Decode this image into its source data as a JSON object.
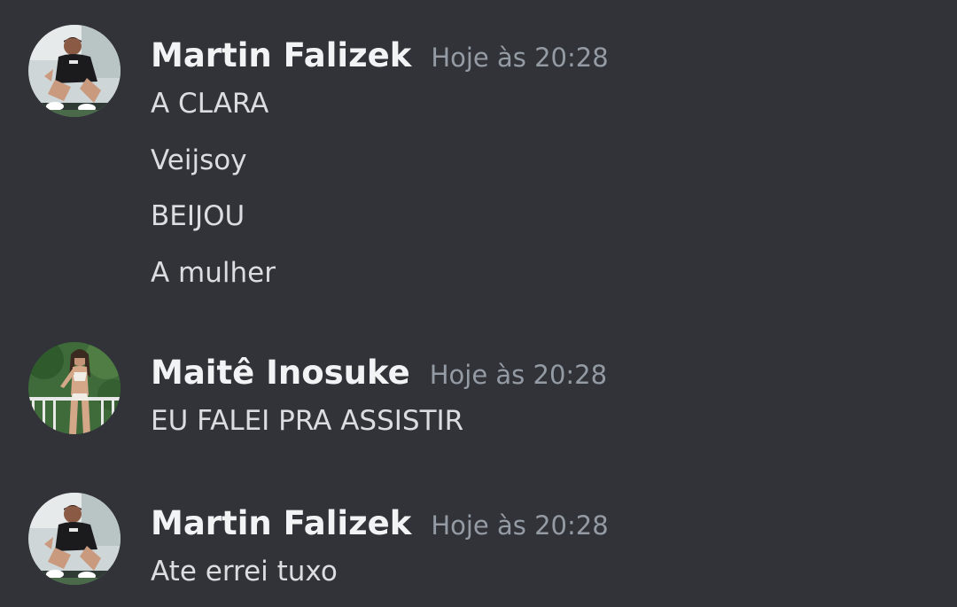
{
  "messages": [
    {
      "author": "Martin Falizek",
      "timestamp": "Hoje às 20:28",
      "avatar": "avatar-man-sitting",
      "lines": [
        "A CLARA",
        "Veijsoy",
        "BEIJOU",
        "A mulher"
      ]
    },
    {
      "author": "Maitê Inosuke",
      "timestamp": "Hoje às 20:28",
      "avatar": "avatar-woman-balcony",
      "lines": [
        "EU FALEI PRA ASSISTIR"
      ]
    },
    {
      "author": "Martin Falizek",
      "timestamp": "Hoje às 20:28",
      "avatar": "avatar-man-sitting",
      "lines": [
        "Ate errei tuxo"
      ]
    }
  ],
  "colors": {
    "background": "#313338",
    "author": "#f2f3f5",
    "timestamp": "#949ba4",
    "message_text": "#dbdee1"
  }
}
